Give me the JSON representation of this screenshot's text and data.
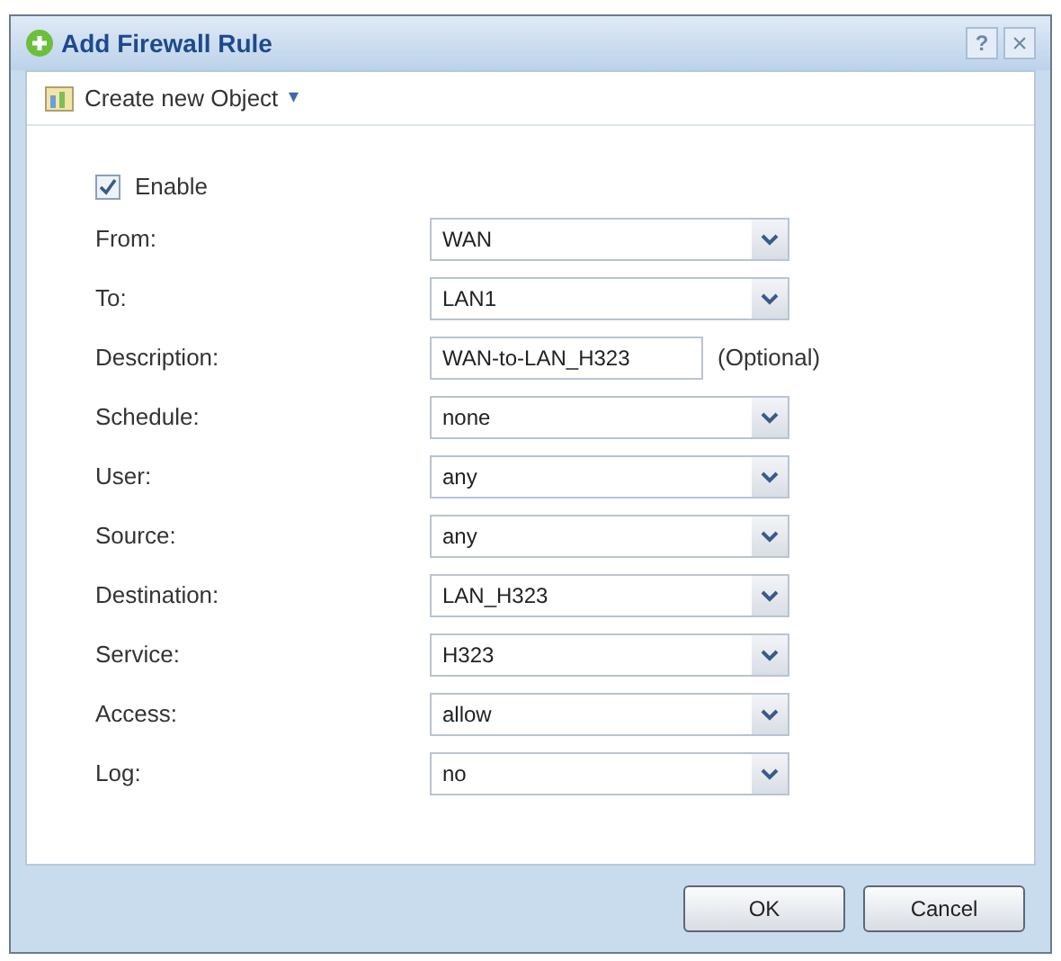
{
  "window": {
    "title": "Add Firewall Rule",
    "help": "?",
    "close": "×"
  },
  "toolbar": {
    "label": "Create new Object",
    "caret": "▾"
  },
  "enable": {
    "label": "Enable",
    "checked": true
  },
  "fields": [
    {
      "kind": "select",
      "label": "From:",
      "value": "WAN"
    },
    {
      "kind": "select",
      "label": "To:",
      "value": "LAN1"
    },
    {
      "kind": "text",
      "label": "Description:",
      "value": "WAN-to-LAN_H323",
      "note": "(Optional)"
    },
    {
      "kind": "select",
      "label": "Schedule:",
      "value": "none"
    },
    {
      "kind": "select",
      "label": "User:",
      "value": "any"
    },
    {
      "kind": "select",
      "label": "Source:",
      "value": "any"
    },
    {
      "kind": "select",
      "label": "Destination:",
      "value": "LAN_H323"
    },
    {
      "kind": "select",
      "label": "Service:",
      "value": "H323"
    },
    {
      "kind": "select",
      "label": "Access:",
      "value": "allow"
    },
    {
      "kind": "select",
      "label": "Log:",
      "value": "no"
    }
  ],
  "buttons": [
    "OK",
    "Cancel"
  ]
}
